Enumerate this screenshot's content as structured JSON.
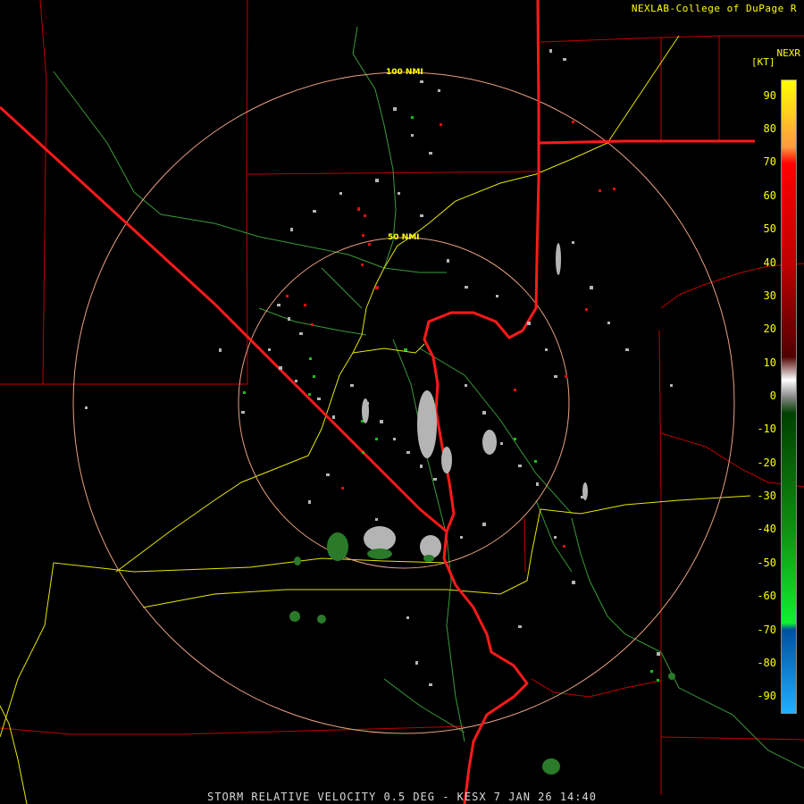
{
  "header": {
    "credit": "NEXLAB-College of DuPage R",
    "product_code": "NEXR",
    "units": "[KT]"
  },
  "map": {
    "range_rings": [
      {
        "label": "50 NMI",
        "radius_nmi": 50
      },
      {
        "label": "100 NMI",
        "radius_nmi": 100
      }
    ],
    "colors": {
      "range_ring": "#e8a080",
      "state_border": "#ff1a1a",
      "county_border": "#c00000",
      "major_road": "#e6e600",
      "minor_road": "#3a9a3a",
      "inbound": "#16c016",
      "outbound": "#e01010",
      "near_zero": "#b4b4b4"
    }
  },
  "legend": {
    "title": "[KT]",
    "ticks": [
      "90",
      "80",
      "70",
      "60",
      "50",
      "40",
      "30",
      "20",
      "10",
      "0",
      "-10",
      "-20",
      "-30",
      "-40",
      "-50",
      "-60",
      "-70",
      "-80",
      "-90"
    ],
    "range": [
      -95,
      95
    ],
    "gradient": [
      {
        "value": 95,
        "color": "#ffff00"
      },
      {
        "value": 75,
        "color": "#ff9a40"
      },
      {
        "value": 70,
        "color": "#ff0000"
      },
      {
        "value": 40,
        "color": "#c00000"
      },
      {
        "value": 12,
        "color": "#500000"
      },
      {
        "value": 5,
        "color": "#ffffff"
      },
      {
        "value": 0,
        "color": "#8a8a8a"
      },
      {
        "value": -5,
        "color": "#004000"
      },
      {
        "value": -40,
        "color": "#109010"
      },
      {
        "value": -68,
        "color": "#10f030"
      },
      {
        "value": -70,
        "color": "#0050a0"
      },
      {
        "value": -95,
        "color": "#20b0ff"
      }
    ]
  },
  "footer": {
    "caption": "STORM RELATIVE VELOCITY 0.5 DEG - KESX 7 JAN 26 14:40"
  }
}
